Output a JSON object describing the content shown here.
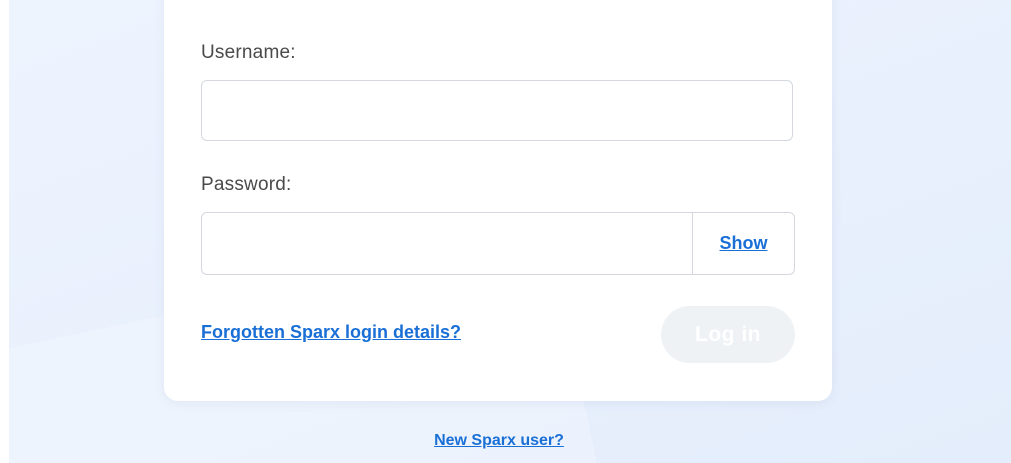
{
  "form": {
    "username_label": "Username:",
    "username_value": "",
    "password_label": "Password:",
    "password_value": "",
    "show_label": "Show",
    "forgot_link": "Forgotten Sparx login details?",
    "login_label": "Log in",
    "login_enabled": false
  },
  "footer": {
    "new_user_link": "New Sparx user?"
  },
  "colors": {
    "link": "#1a6fd6",
    "background": "#eaf1fd",
    "login_disabled": "#eef2f5"
  }
}
